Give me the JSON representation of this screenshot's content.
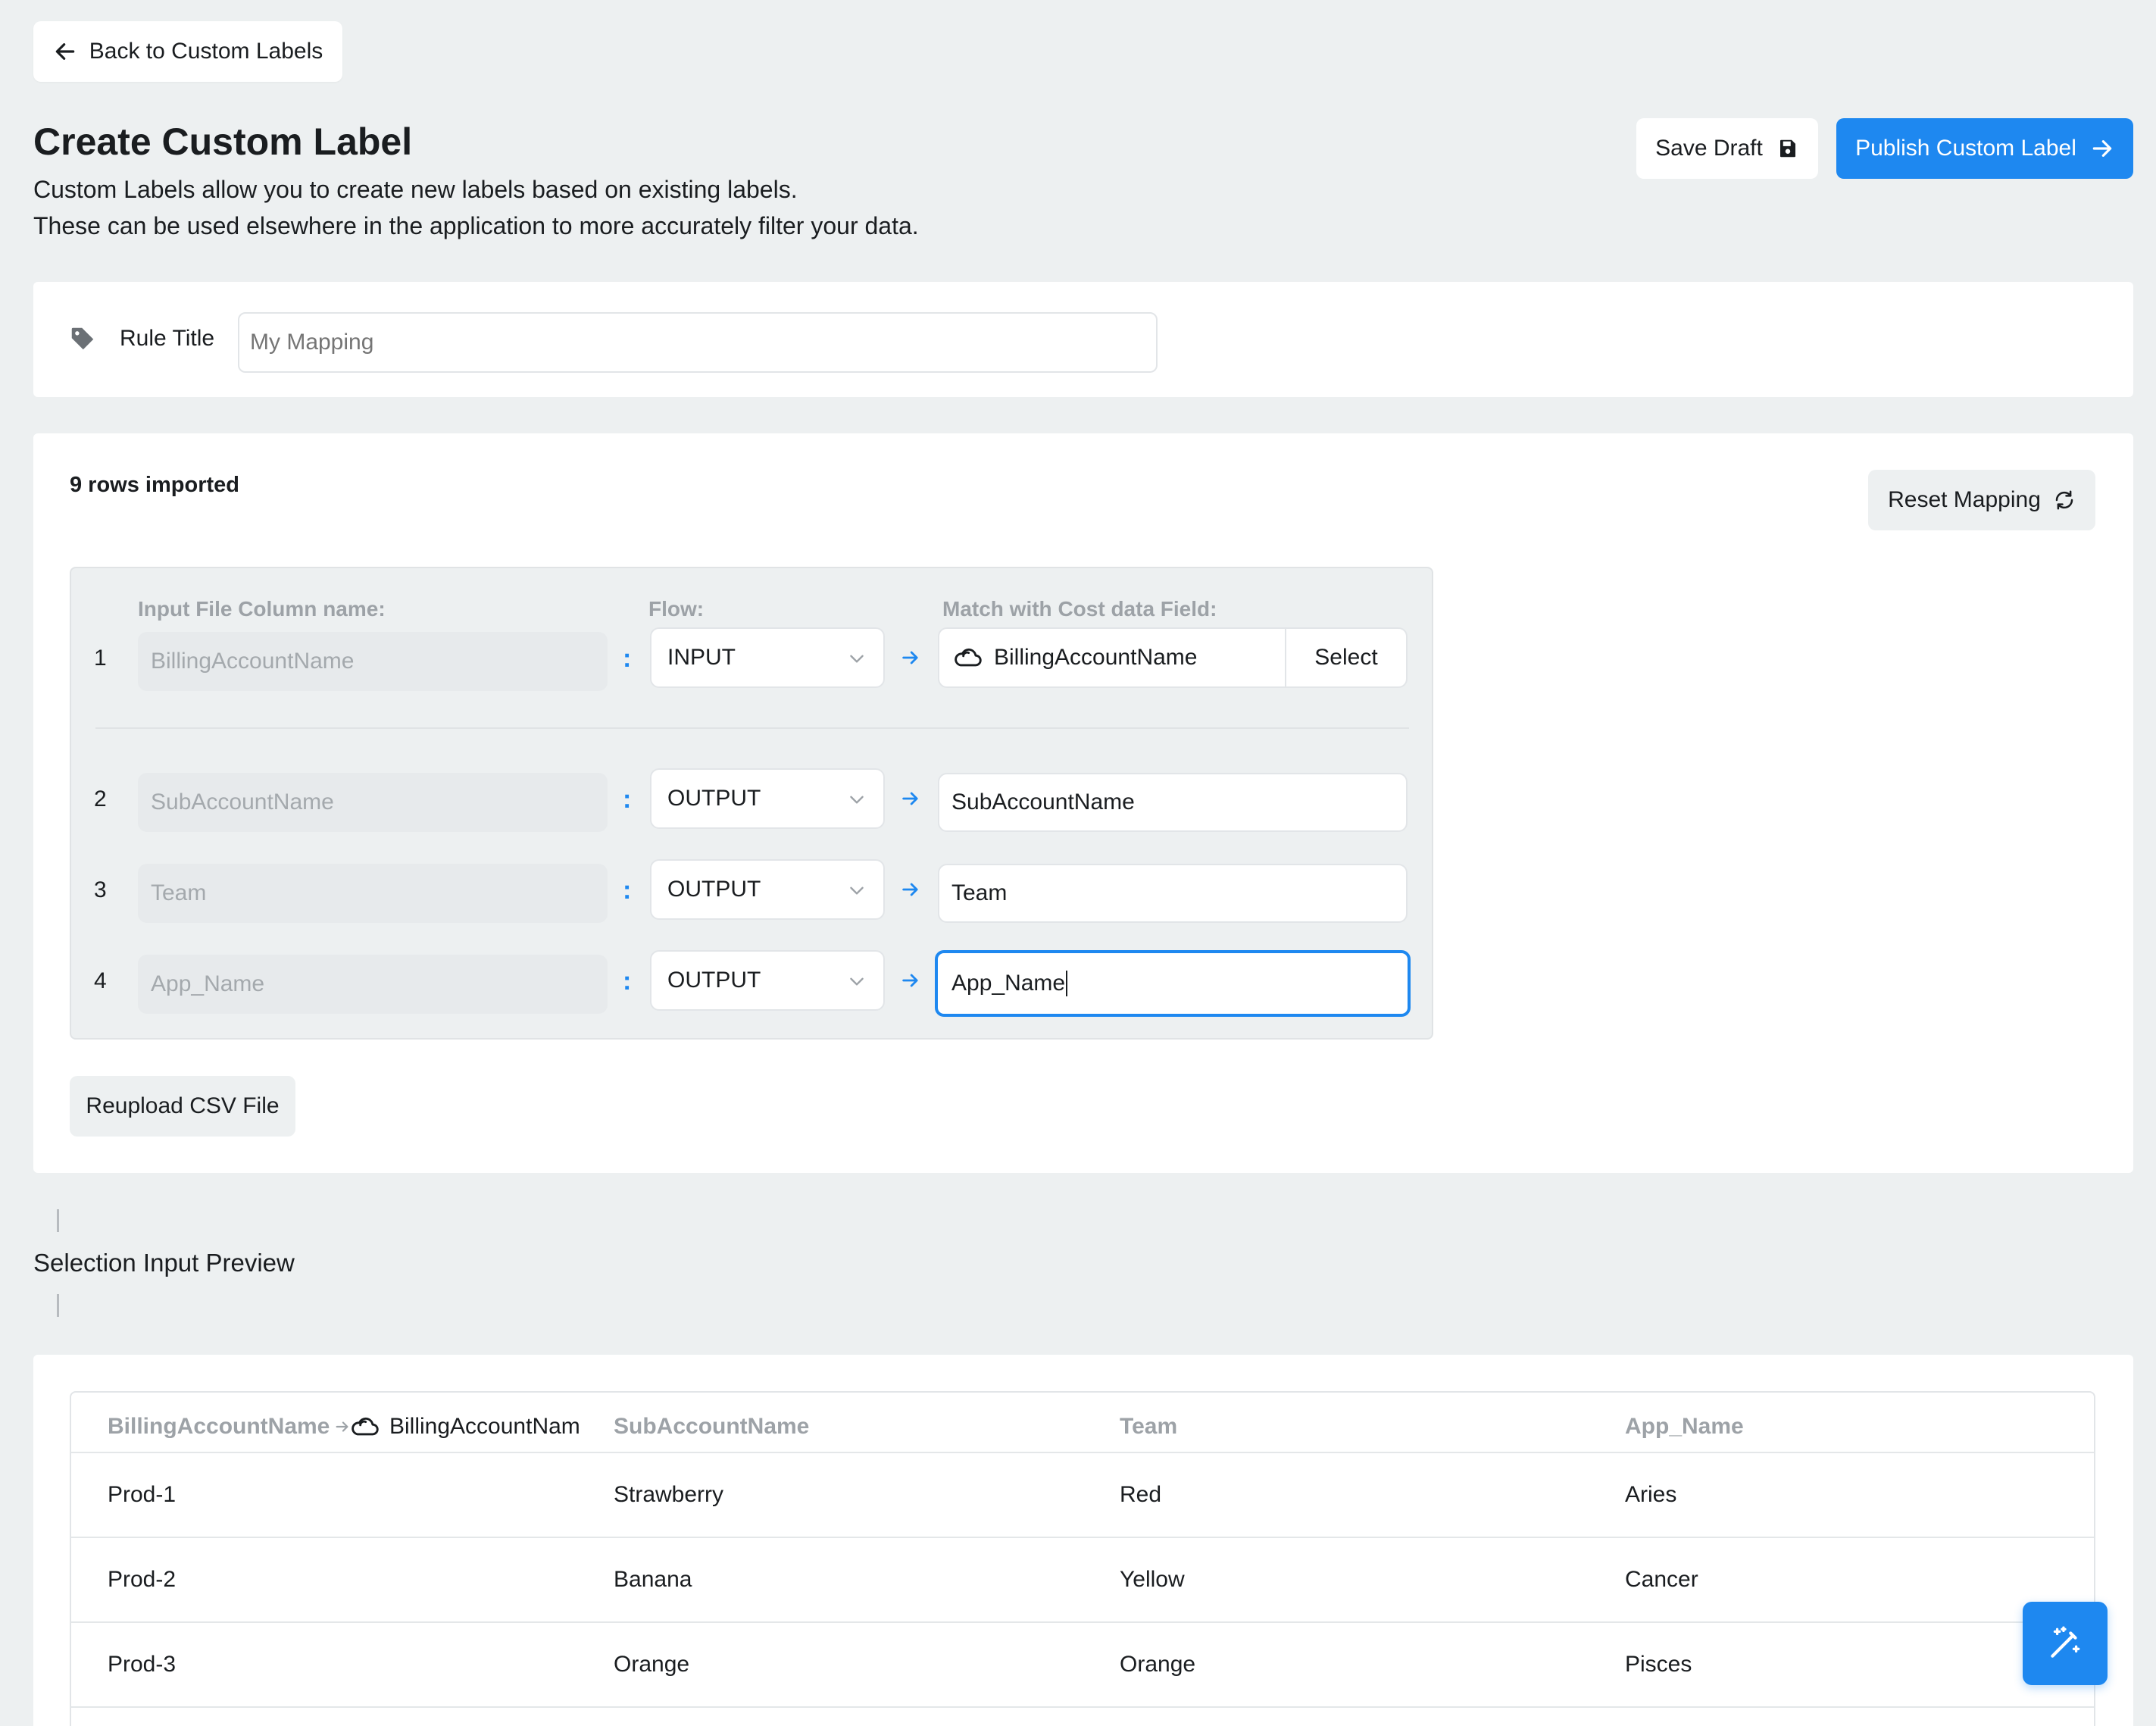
{
  "back_button": {
    "label": "Back to Custom Labels"
  },
  "header": {
    "title": "Create Custom Label",
    "description_line1": "Custom Labels allow you to create new labels based on existing labels.",
    "description_line2": "These can be used elsewhere in the application to more accurately filter your data.",
    "save_draft_label": "Save Draft",
    "publish_label": "Publish Custom Label"
  },
  "rule_title": {
    "label": "Rule Title",
    "placeholder": "My Mapping",
    "value": ""
  },
  "mapping": {
    "rows_imported": "9 rows imported",
    "reset_label": "Reset Mapping",
    "headers": {
      "input_column": "Input File Column name:",
      "flow": "Flow:",
      "match_field": "Match with Cost data Field:"
    },
    "colon": ":",
    "rows": [
      {
        "num": "1",
        "column": "BillingAccountName",
        "flow": "INPUT",
        "target": "BillingAccountName",
        "select_label": "Select"
      },
      {
        "num": "2",
        "column": "SubAccountName",
        "flow": "OUTPUT",
        "target": "SubAccountName"
      },
      {
        "num": "3",
        "column": "Team",
        "flow": "OUTPUT",
        "target": "Team"
      },
      {
        "num": "4",
        "column": "App_Name",
        "flow": "OUTPUT",
        "target": "App_Name"
      }
    ],
    "reupload_label": "Reupload CSV File"
  },
  "preview": {
    "title": "Selection Input Preview",
    "columns": {
      "c1_source": "BillingAccountName",
      "c1_target": "BillingAccountNam",
      "c2": "SubAccountName",
      "c3": "Team",
      "c4": "App_Name"
    },
    "rows": [
      [
        "Prod-1",
        "Strawberry",
        "Red",
        "Aries"
      ],
      [
        "Prod-2",
        "Banana",
        "Yellow",
        "Cancer"
      ],
      [
        "Prod-3",
        "Orange",
        "Orange",
        "Pisces"
      ]
    ]
  },
  "colors": {
    "accent": "#1e88f0",
    "background": "#edf0f1",
    "card": "#ffffff"
  },
  "icons": {
    "back": "arrow-left-icon",
    "save": "floppy-disk-icon",
    "publish": "arrow-right-icon",
    "tag": "tag-icon",
    "reset": "refresh-icon",
    "cloud": "cloud-icon",
    "chevron": "chevron-down-icon",
    "magic": "magic-wand-icon"
  }
}
